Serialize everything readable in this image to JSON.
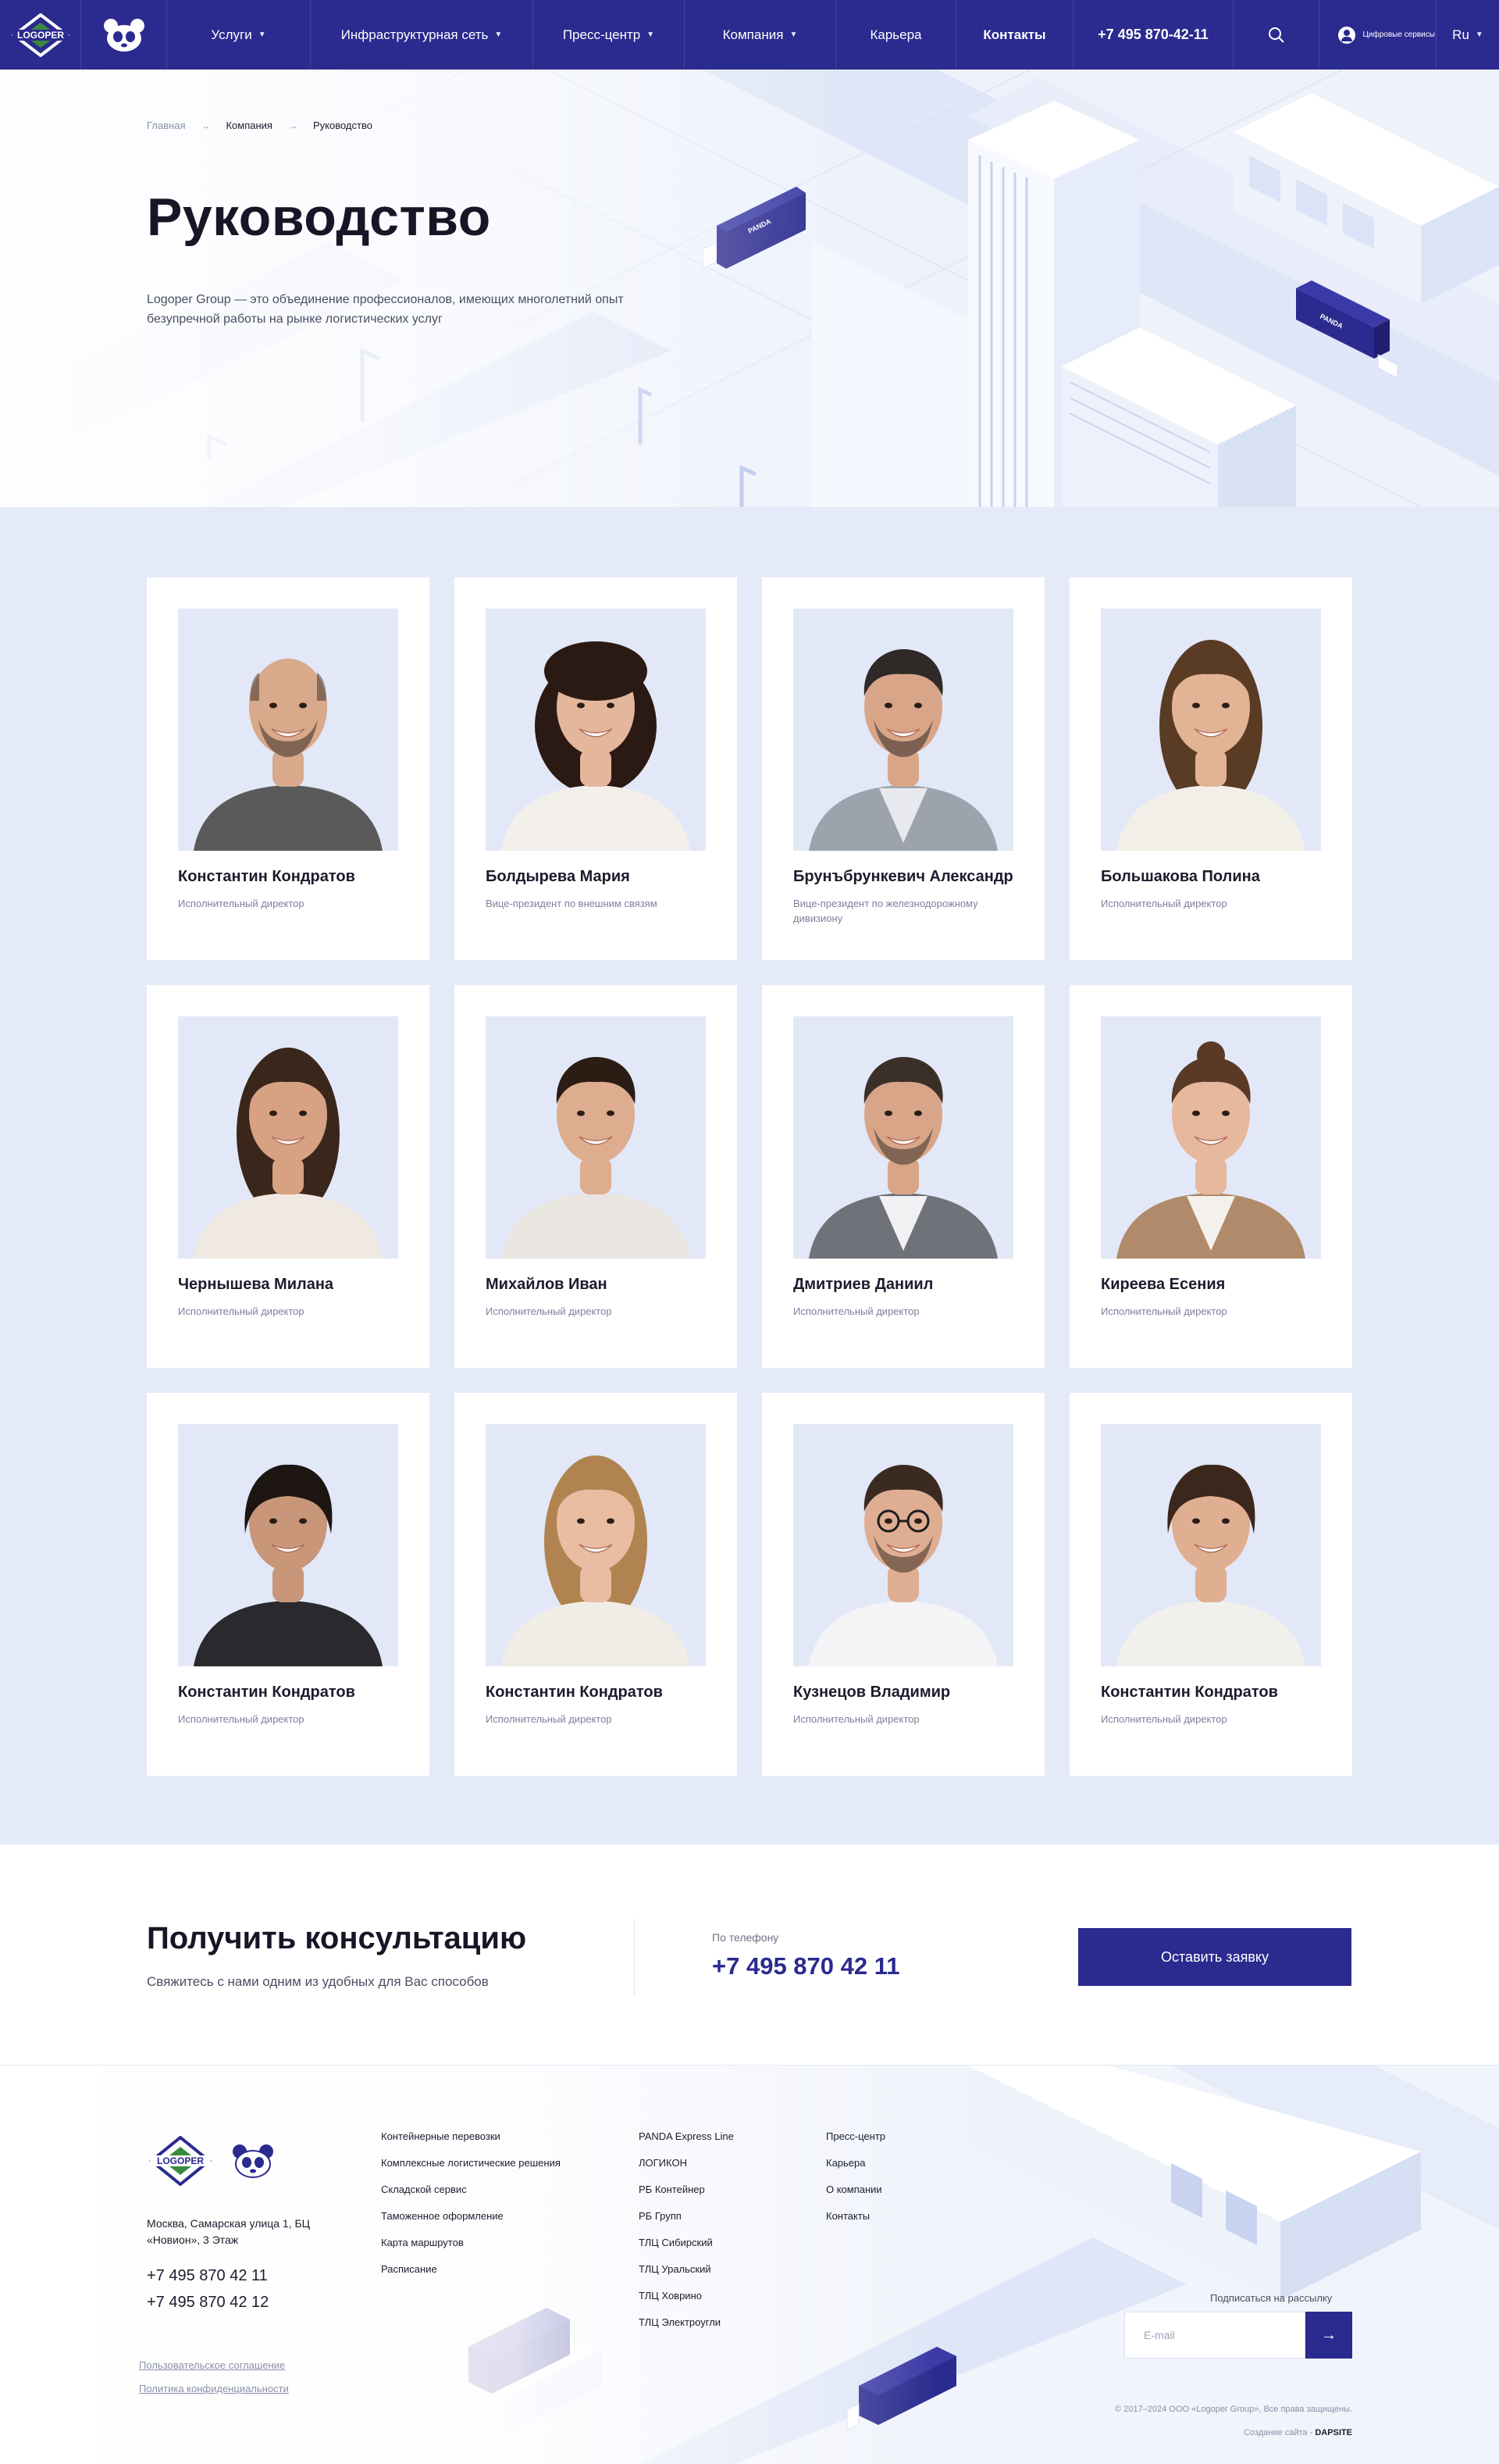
{
  "header": {
    "logo_text": "LOGOPER",
    "nav": [
      {
        "label": "Услуги",
        "dropdown": true
      },
      {
        "label": "Инфраструктурная сеть",
        "dropdown": true
      },
      {
        "label": "Пресс-центр",
        "dropdown": true
      },
      {
        "label": "Компания",
        "dropdown": true
      },
      {
        "label": "Карьера",
        "dropdown": false
      },
      {
        "label": "Контакты",
        "dropdown": false
      }
    ],
    "phone": "+7 495 870-42-11",
    "digital_services": "Цифровые сервисы",
    "language": "Ru",
    "icons": [
      "search-icon",
      "user-icon",
      "chevron-down-icon"
    ]
  },
  "breadcrumb": [
    {
      "label": "Главная"
    },
    {
      "label": "Компания"
    },
    {
      "label": "Руководство"
    }
  ],
  "hero": {
    "title": "Руководство",
    "lead": "Logoper Group — это объединение профессионалов, имеющих многолетний опыт безупречной работы на рынке логистических услуг",
    "truck_label": "PANDA"
  },
  "team": [
    {
      "name": "Константин Кондратов",
      "role": "Исполнительный директор"
    },
    {
      "name": "Болдырева Мария",
      "role": "Вице-президент по внешним связям"
    },
    {
      "name": "Брунъбрункевич Александр",
      "role": "Вице-президент по железнодорожному дивизиону"
    },
    {
      "name": "Большакова Полина",
      "role": "Исполнительный директор"
    },
    {
      "name": "Чернышева Милана",
      "role": "Исполнительный директор"
    },
    {
      "name": "Михайлов Иван",
      "role": "Исполнительный директор"
    },
    {
      "name": "Дмитриев Даниил",
      "role": "Исполнительный директор"
    },
    {
      "name": "Киреева Есения",
      "role": "Исполнительный директор"
    },
    {
      "name": "Константин Кондратов",
      "role": "Исполнительный директор"
    },
    {
      "name": "Константин Кондратов",
      "role": "Исполнительный директор"
    },
    {
      "name": "Кузнецов Владимир",
      "role": "Исполнительный директор"
    },
    {
      "name": "Константин Кондратов",
      "role": "Исполнительный директор"
    }
  ],
  "consult": {
    "title": "Получить консультацию",
    "subtitle": "Свяжитесь с нами одним из удобных для Вас способов",
    "phone_label": "По телефону",
    "phone": "+7 495 870 42 11",
    "button": "Оставить заявку"
  },
  "footer": {
    "address": "Москва, Самарская улица 1, БЦ «Новион», 3 Этаж",
    "phone1": "+7 495 870 42 11",
    "phone2": "+7 495 870 42 12",
    "legal": [
      "Пользовательское соглашение",
      "Политика конфиденциальности"
    ],
    "col1": [
      "Контейнерные перевозки",
      "Комплексные логистические решения",
      "Складской сервис",
      "Таможенное оформление",
      "Карта маршрутов",
      "Расписание"
    ],
    "col2": [
      "PANDA Express Line",
      "ЛОГИКОН",
      "РБ Контейнер",
      "РБ Групп",
      "ТЛЦ Сибирский",
      "ТЛЦ Уральский",
      "ТЛЦ Ховрино",
      "ТЛЦ Электроугли"
    ],
    "col3": [
      "Пресс-центр",
      "Карьера",
      "О компании",
      "Контакты"
    ],
    "subscribe_label": "Подписаться на рассылку",
    "email_placeholder": "E-mail",
    "submit_icon": "→",
    "copyright": "© 2017–2024 ООО «Logoper Group», Все права защищены.",
    "made_by_prefix": "Создание сайта - ",
    "made_by": "DAPSITE"
  },
  "colors": {
    "brand": "#2b2a8f",
    "team_bg": "#e4eaf8",
    "photo_bg": "#e2e8f7"
  }
}
